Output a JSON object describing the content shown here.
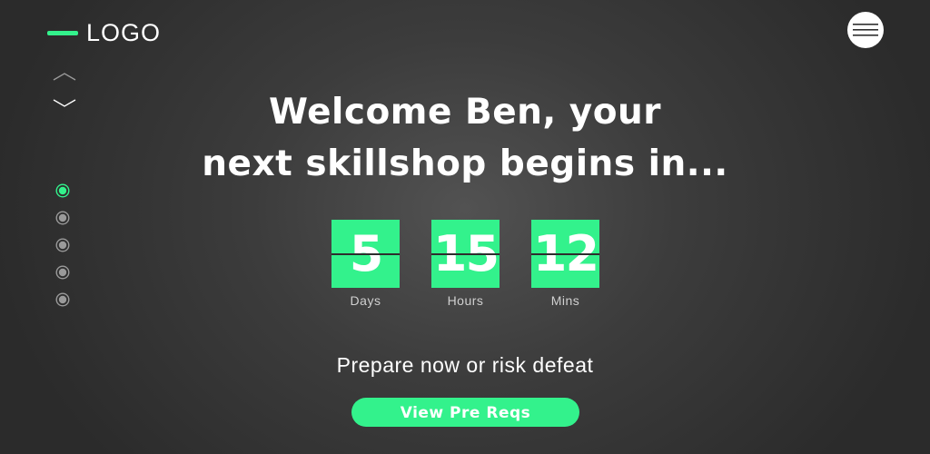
{
  "colors": {
    "accent": "#33f28c",
    "background_center": "#525252",
    "background_edge": "#2b2b2b",
    "text": "#ffffff",
    "muted_text": "#d0d0d0",
    "inactive_dot": "#9a9a9a"
  },
  "header": {
    "logo_text": "LOGO",
    "menu_icon": "hamburger-icon"
  },
  "side_nav": {
    "up_icon": "chevron-up-icon",
    "down_icon": "chevron-down-icon",
    "dots": [
      {
        "active": true
      },
      {
        "active": false
      },
      {
        "active": false
      },
      {
        "active": false
      },
      {
        "active": false
      }
    ]
  },
  "hero": {
    "headline_line1": "Welcome Ben, your",
    "headline_line2": "next skillshop begins in...",
    "countdown": [
      {
        "value": "5",
        "label": "Days"
      },
      {
        "value": "15",
        "label": "Hours"
      },
      {
        "value": "12",
        "label": "Mins"
      }
    ],
    "tagline": "Prepare now or risk defeat",
    "cta_label": "View Pre Reqs"
  }
}
